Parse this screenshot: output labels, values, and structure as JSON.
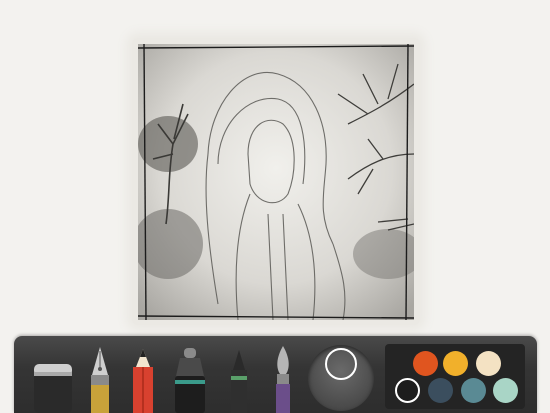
{
  "app": {
    "canvas": {
      "label": ""
    },
    "tools": [
      {
        "name": "eraser",
        "icon": "eraser-icon"
      },
      {
        "name": "fountain-pen",
        "icon": "fountain-pen-icon"
      },
      {
        "name": "pencil",
        "icon": "pencil-icon"
      },
      {
        "name": "marker",
        "icon": "marker-icon"
      },
      {
        "name": "fineliner",
        "icon": "fineliner-icon"
      },
      {
        "name": "brush",
        "icon": "brush-icon"
      }
    ],
    "colors": {
      "swatches": [
        "#e0551f",
        "#f1b02b",
        "#f4e2c3",
        "#1d1d1d",
        "#3b4e5e",
        "#5a8a94",
        "#a9d5c6"
      ],
      "selected_index": 3,
      "mixer_color": "#505050"
    }
  }
}
